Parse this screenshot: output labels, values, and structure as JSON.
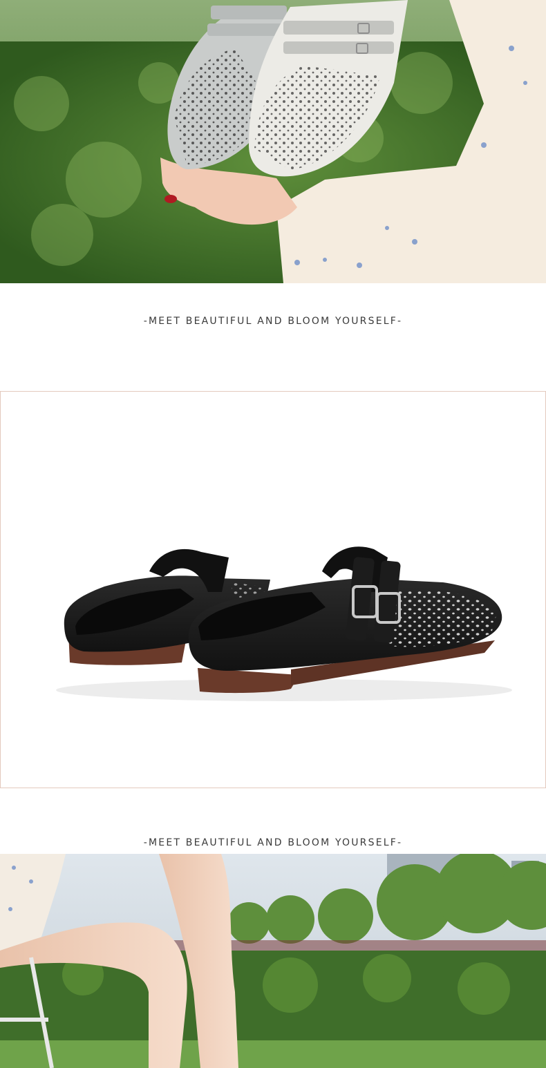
{
  "sections": {
    "tagline_1": "-MEET BEAUTIFUL AND BLOOM YOURSELF-",
    "tagline_2": "-MEET BEAUTIFUL AND BLOOM YOURSELF-"
  },
  "colors": {
    "hedge_green": "#3f6e2a",
    "shoe_grey": "#c9cccb",
    "shoe_black": "#1b1b1b",
    "sole_brown": "#6a3a2a",
    "frame_border": "#e3c9bd"
  }
}
